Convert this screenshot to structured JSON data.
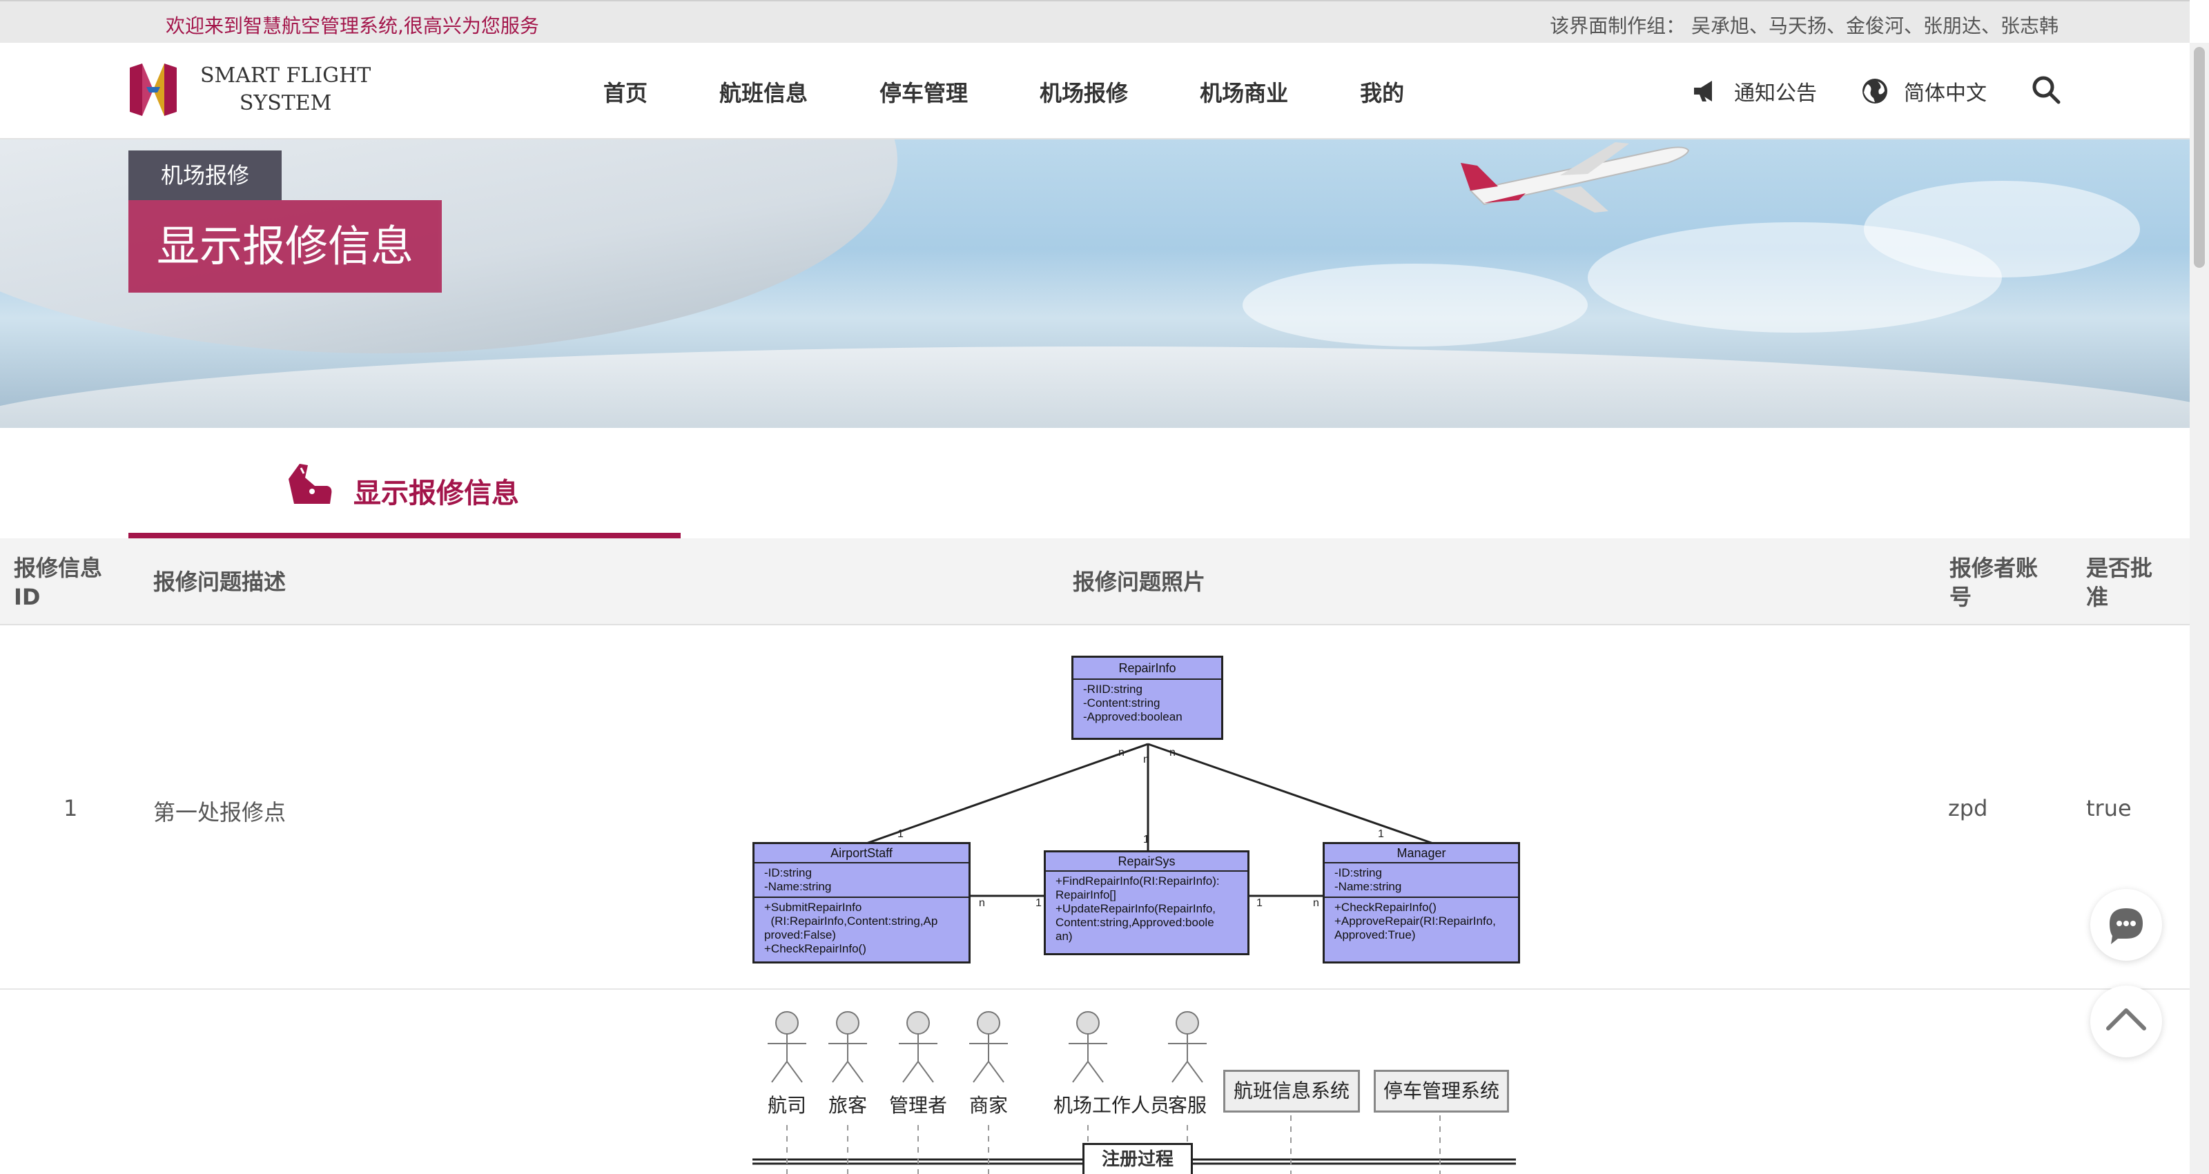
{
  "topbar": {
    "welcome": "欢迎来到智慧航空管理系统,很高兴为您服务",
    "credits": "该界面制作组：  吴承旭、马天扬、金俊河、张朋达、张志韩"
  },
  "header": {
    "logo_line1": "SMART FLIGHT",
    "logo_line2": "SYSTEM",
    "nav": [
      "首页",
      "航班信息",
      "停车管理",
      "机场报修",
      "机场商业",
      "我的"
    ],
    "notice_label": "通知公告",
    "language_label": "简体中文"
  },
  "banner": {
    "crumb": "机场报修",
    "title": "显示报修信息"
  },
  "section": {
    "tab_label": "显示报修信息"
  },
  "table": {
    "headers": {
      "id": "报修信息 ID",
      "desc": "报修问题描述",
      "photo": "报修问题照片",
      "account": "报修者账号",
      "approved": "是否批准"
    },
    "rows": [
      {
        "id": "1",
        "desc": "第一处报修点",
        "account": "zpd",
        "approved": "true"
      }
    ]
  },
  "uml": {
    "repairinfo": {
      "title": "RepairInfo",
      "attrs": "-RIID:string\n-Content:string\n-Approved:boolean"
    },
    "airportstaff": {
      "title": "AirportStaff",
      "attrs": "-ID:string\n-Name:string",
      "ops": "+SubmitRepairInfo\n  (RI:RepairInfo,Content:string,Ap\nproved:False)\n+CheckRepairInfo()"
    },
    "repairsys": {
      "title": "RepairSys",
      "ops": "+FindRepairInfo(RI:RepairInfo):\nRepairInfo[]\n+UpdateRepairInfo(RepairInfo,\nContent:string,Approved:boole\nan)"
    },
    "manager": {
      "title": "Manager",
      "attrs": "-ID:string\n-Name:string",
      "ops": "+CheckRepairInfo()\n+ApproveRepair(RI:RepairInfo,\nApproved:True)"
    },
    "mult_one": "1",
    "mult_n": "n"
  },
  "seq": {
    "actors": [
      "航司",
      "旅客",
      "管理者",
      "商家",
      "机场工作人员",
      "客服"
    ],
    "systems": [
      "航班信息系统",
      "停车管理系统"
    ],
    "step": "注册过程"
  },
  "colors": {
    "brand": "#a3154a",
    "uml_fill": "#a9aaf3"
  }
}
